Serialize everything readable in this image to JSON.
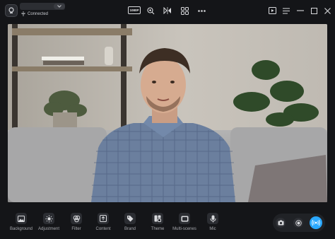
{
  "titlebar": {
    "status_text": "Connected",
    "resolution_badge": "1080P",
    "icons": [
      "app-logo-icon",
      "zoom-in-icon",
      "mirror-icon",
      "grid-icon",
      "more-icon",
      "play-icon",
      "menu-icon",
      "minimize-icon",
      "maximize-icon",
      "close-icon"
    ]
  },
  "toolbar": {
    "items": [
      {
        "label": "Background",
        "icon": "image-icon"
      },
      {
        "label": "Adjustment",
        "icon": "sun-icon"
      },
      {
        "label": "Filter",
        "icon": "filter-icon"
      },
      {
        "label": "Content",
        "icon": "upload-icon"
      },
      {
        "label": "Brand",
        "icon": "tag-icon"
      },
      {
        "label": "Theme",
        "icon": "theme-icon"
      },
      {
        "label": "Multi-scenes",
        "icon": "scenes-icon"
      },
      {
        "label": "Mic",
        "icon": "mic-icon"
      }
    ]
  },
  "right_controls": [
    "camera-icon",
    "record-icon",
    "live-icon"
  ],
  "colors": {
    "background": "#141518",
    "accent": "#2aa8ff",
    "text": "#e6e6e8"
  }
}
